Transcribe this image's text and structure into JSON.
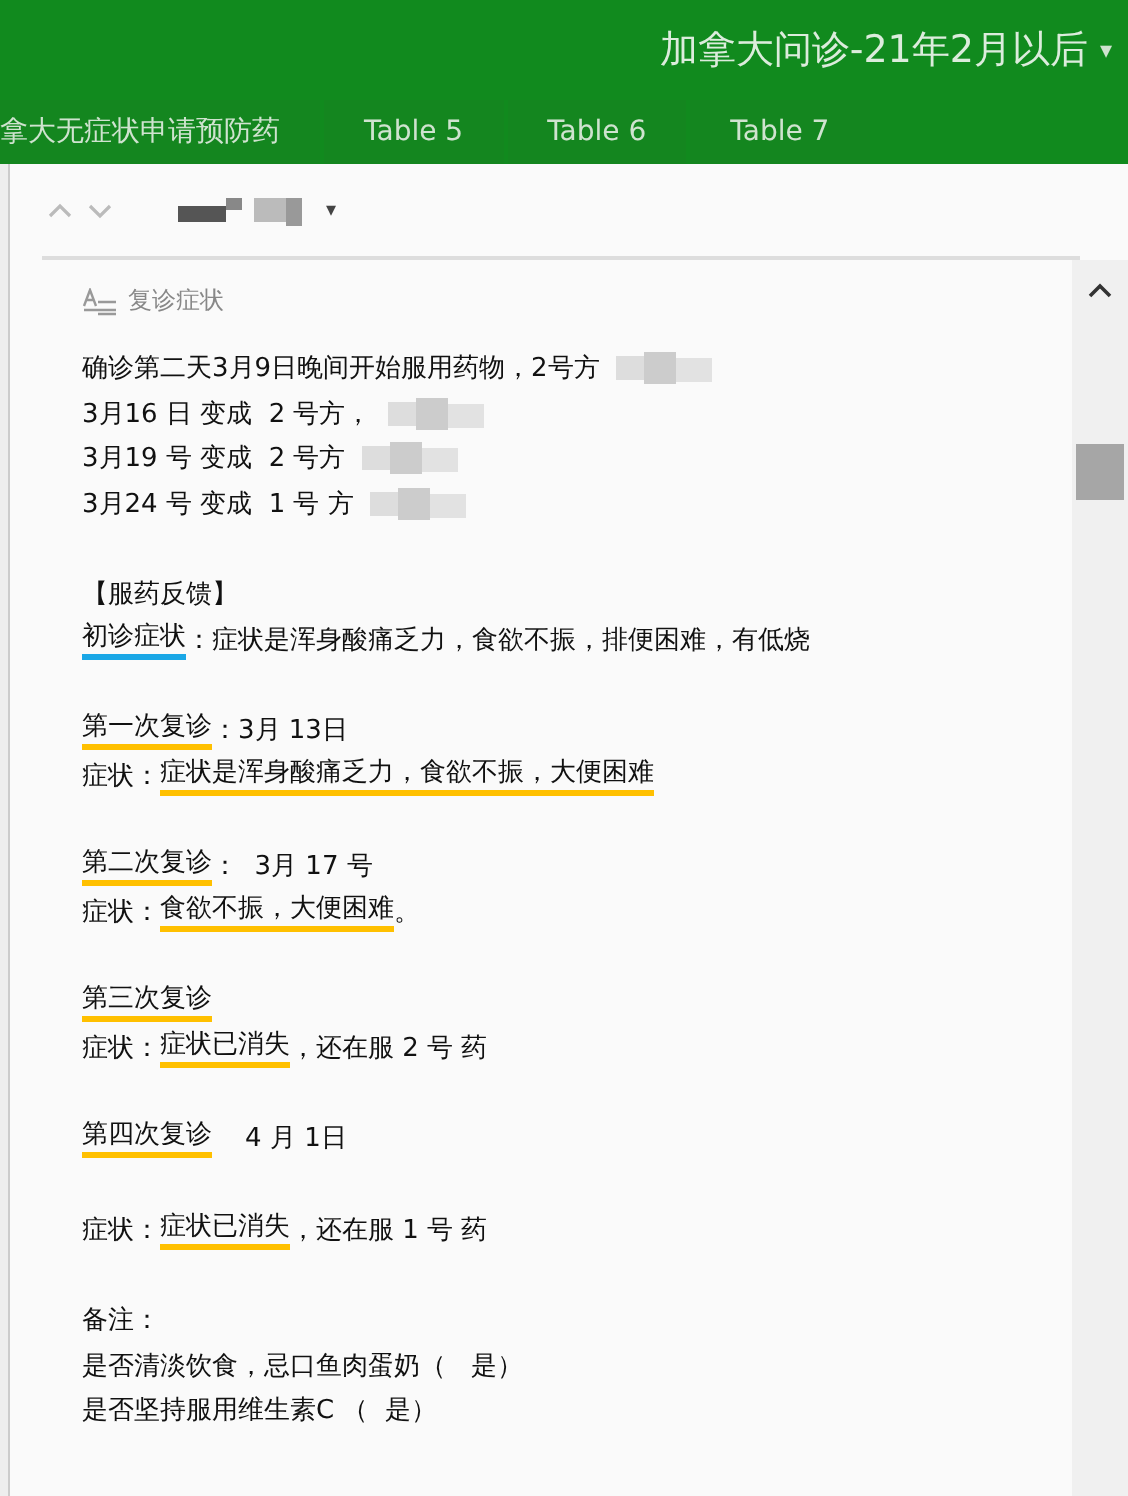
{
  "header": {
    "title": "加拿大问诊-21年2月以后",
    "caret": "▾"
  },
  "tabs": [
    {
      "label": "拿大无症状申请预防药",
      "selected": false
    },
    {
      "label": "Table 5",
      "selected": false
    },
    {
      "label": "Table 6",
      "selected": false
    },
    {
      "label": "Table 7",
      "selected": false
    }
  ],
  "record_toolbar": {
    "caret": "▾"
  },
  "field": {
    "label": "复诊症状",
    "paragraphs": [
      {
        "lines": [
          {
            "redacted": true,
            "segments": [
              {
                "text": "确诊第二天3月9日晚间开始服用药物，2号方",
                "underlined": false
              }
            ]
          },
          {
            "redacted": true,
            "segments": [
              {
                "text": "3月16 日 变成  2 号方，",
                "underlined": false
              }
            ]
          },
          {
            "redacted": true,
            "segments": [
              {
                "text": "3月19 号 变成  2 号方",
                "underlined": false
              }
            ]
          },
          {
            "redacted": true,
            "segments": [
              {
                "text": "3月24 号 变成  1 号 方",
                "underlined": false
              }
            ]
          }
        ]
      },
      {
        "lines": [
          {
            "redacted": false,
            "segments": [
              {
                "text": "【服药反馈】",
                "underlined": false
              }
            ]
          },
          {
            "redacted": false,
            "segments": [
              {
                "text": "初诊症状",
                "underlined": true,
                "color": "#1aa7e6"
              },
              {
                "text": "：症状是浑身酸痛乏力，食欲不振，排便困难，有低烧",
                "underlined": false
              }
            ]
          }
        ]
      },
      {
        "lines": [
          {
            "redacted": false,
            "segments": [
              {
                "text": "第一次复诊",
                "underlined": true,
                "color": "#ffc000"
              },
              {
                "text": "：3月 13日",
                "underlined": false
              }
            ]
          },
          {
            "redacted": false,
            "segments": [
              {
                "text": "症状：",
                "underlined": false
              },
              {
                "text": "症状是浑身酸痛乏力，食欲不振，大便困难",
                "underlined": true,
                "color": "#ffc000"
              }
            ]
          }
        ]
      },
      {
        "lines": [
          {
            "redacted": false,
            "segments": [
              {
                "text": "第二次复诊",
                "underlined": true,
                "color": "#ffc000"
              },
              {
                "text": "：  3月 17 号",
                "underlined": false
              }
            ]
          },
          {
            "redacted": false,
            "segments": [
              {
                "text": "症状：",
                "underlined": false
              },
              {
                "text": "食欲不振，大便困难",
                "underlined": true,
                "color": "#ffc000"
              },
              {
                "text": "。",
                "underlined": false
              }
            ]
          }
        ]
      },
      {
        "lines": [
          {
            "redacted": false,
            "segments": [
              {
                "text": "第三次复诊",
                "underlined": true,
                "color": "#ffc000"
              }
            ]
          },
          {
            "redacted": false,
            "segments": [
              {
                "text": "症状：",
                "underlined": false
              },
              {
                "text": "症状已消失",
                "underlined": true,
                "color": "#ffc000"
              },
              {
                "text": "，还在服 2 号 药",
                "underlined": false
              }
            ]
          }
        ]
      },
      {
        "lines": [
          {
            "redacted": false,
            "segments": [
              {
                "text": "第四次复诊",
                "underlined": true,
                "color": "#ffc000"
              },
              {
                "text": "    4 月 1日",
                "underlined": false
              }
            ]
          }
        ]
      },
      {
        "lines": [
          {
            "redacted": false,
            "segments": [
              {
                "text": "症状：",
                "underlined": false
              },
              {
                "text": "症状已消失",
                "underlined": true,
                "color": "#ffc000"
              },
              {
                "text": "，还在服 1 号 药",
                "underlined": false
              }
            ]
          }
        ]
      },
      {
        "lines": [
          {
            "redacted": false,
            "segments": [
              {
                "text": "备注：",
                "underlined": false
              }
            ]
          },
          {
            "redacted": false,
            "segments": [
              {
                "text": "是否清淡饮食，忌口鱼肉蛋奶（   是）",
                "underlined": false
              }
            ]
          },
          {
            "redacted": false,
            "segments": [
              {
                "text": "是否坚持服用维生素C （  是）",
                "underlined": false
              }
            ]
          }
        ]
      }
    ]
  }
}
